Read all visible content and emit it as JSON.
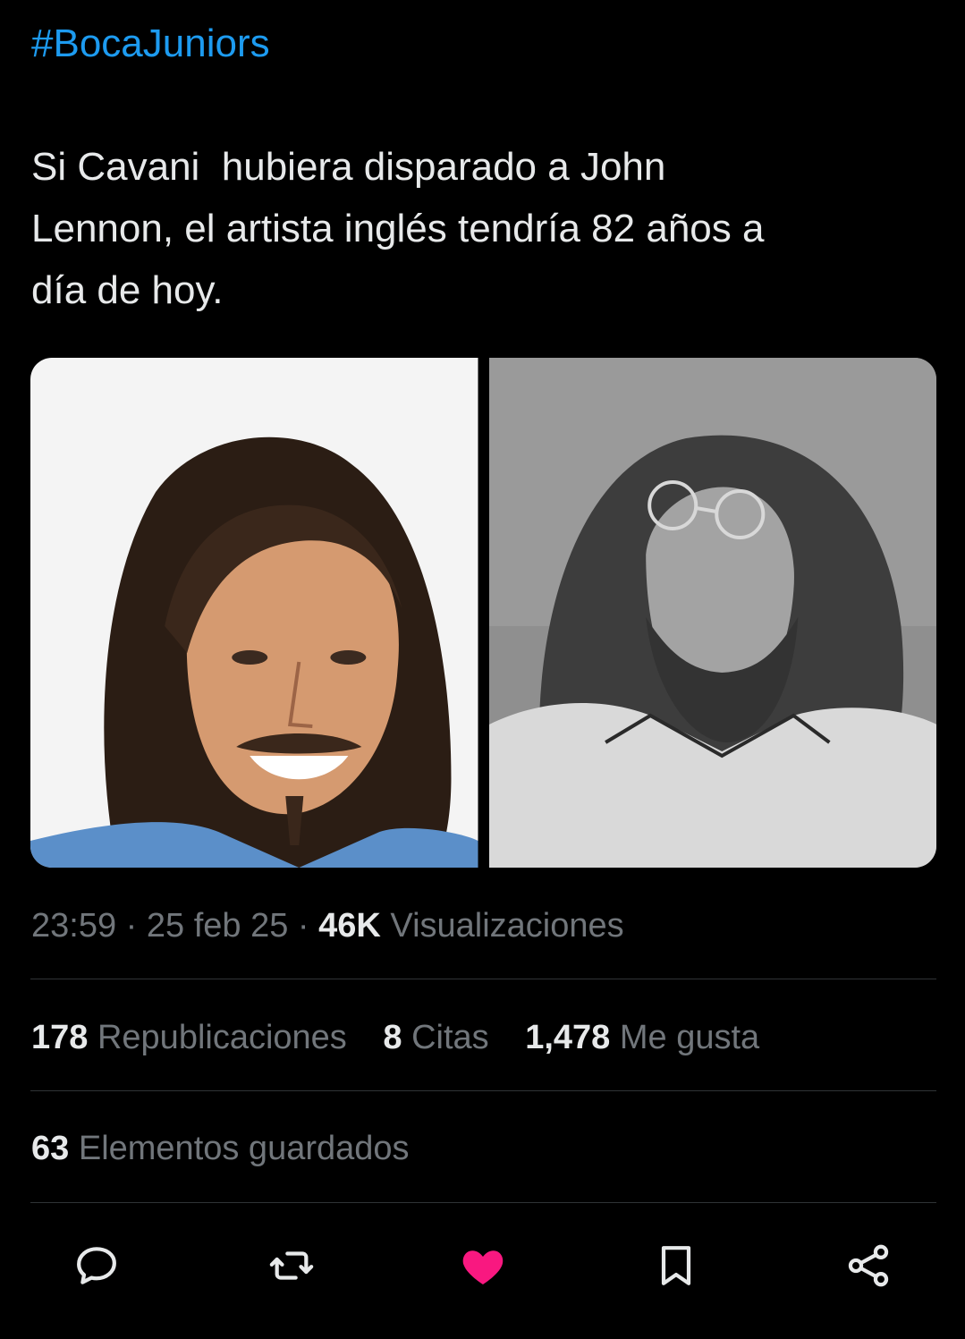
{
  "tweet": {
    "hashtag": "#BocaJuniors",
    "text": "Si Cavani  hubiera disparado a John\nLennon, el artista inglés tendría 82 años a\ndía de hoy.",
    "media": [
      {
        "alt": "photo-cavani"
      },
      {
        "alt": "photo-lennon"
      }
    ]
  },
  "meta": {
    "time": "23:59",
    "date": "25 feb 25",
    "views_count": "46K",
    "views_label": "Visualizaciones",
    "separator": "·"
  },
  "stats": {
    "reposts_count": "178",
    "reposts_label": "Republicaciones",
    "quotes_count": "8",
    "quotes_label": "Citas",
    "likes_count": "1,478",
    "likes_label": "Me gusta",
    "saved_count": "63",
    "saved_label": "Elementos guardados"
  },
  "actions": {
    "reply_icon": "reply-icon",
    "repost_icon": "repost-icon",
    "like_icon": "heart-icon",
    "bookmark_icon": "bookmark-icon",
    "share_icon": "share-icon"
  },
  "colors": {
    "background": "#000000",
    "text": "#e7e9ea",
    "secondary": "#71767b",
    "link": "#1d9bf0",
    "like": "#f91880",
    "divider": "#2f3336"
  }
}
